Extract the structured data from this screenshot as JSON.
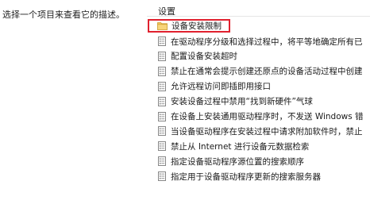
{
  "description_text": "选择一个项目来查看它的描述。",
  "header": {
    "label": "设置"
  },
  "folder": {
    "label": "设备安装限制",
    "icon": "folder-icon"
  },
  "policies": [
    {
      "label": "在驱动程序分级和选择过程中，将平等地确定所有已",
      "icon": "policy-setting-icon"
    },
    {
      "label": "配置设备安装超时",
      "icon": "policy-setting-icon"
    },
    {
      "label": "禁止在通常会提示创建还原点的设备活动过程中创建",
      "icon": "policy-setting-icon"
    },
    {
      "label": "允许远程访问即插即用接口",
      "icon": "policy-setting-icon"
    },
    {
      "label": "安装设备过程中禁用“找到新硬件”气球",
      "icon": "policy-setting-icon"
    },
    {
      "label": "在设备上安装通用驱动程序时，不发送 Windows 错",
      "icon": "policy-setting-icon"
    },
    {
      "label": "当设备驱动程序在安装过程中请求附加软件时，禁止",
      "icon": "policy-setting-icon"
    },
    {
      "label": "禁止从 Internet 进行设备元数据检索",
      "icon": "policy-setting-icon"
    },
    {
      "label": "指定设备驱动程序源位置的搜索顺序",
      "icon": "policy-setting-icon"
    },
    {
      "label": "指定用于设备驱动程序更新的搜索服务器",
      "icon": "policy-setting-icon"
    }
  ],
  "colors": {
    "highlight_border": "#e0212e",
    "folder": "#f2c55c"
  }
}
